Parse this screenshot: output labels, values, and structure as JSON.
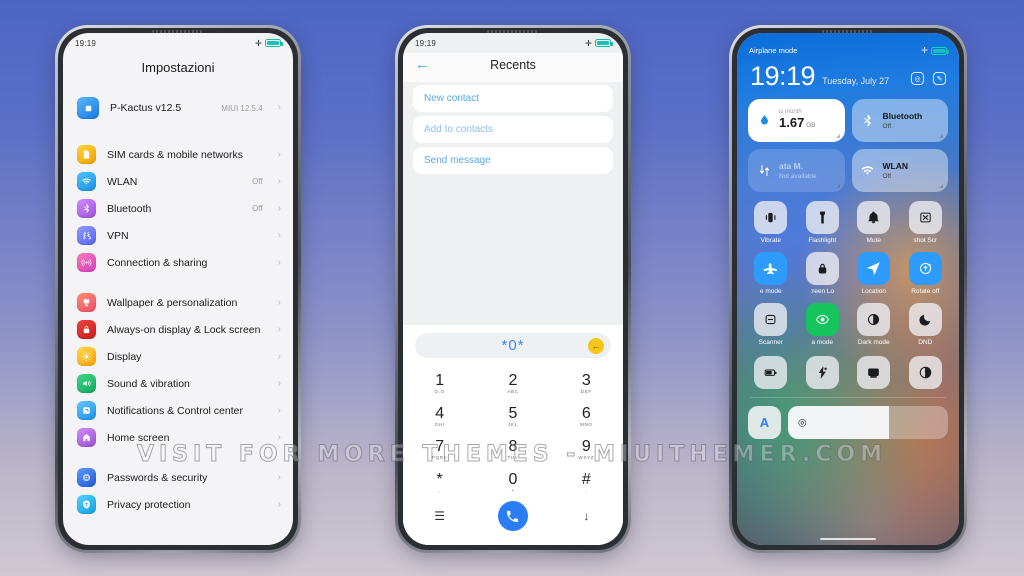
{
  "watermark": "VISIT FOR MORE THEMES - MIUITHEMER.COM",
  "phone1": {
    "status": {
      "time": "19:19"
    },
    "title": "Impostazioni",
    "header_row": {
      "label": "P-Kactus  v12.5",
      "value": "MIUI 12.5.4",
      "icon": "miui-logo-icon"
    },
    "groups": [
      {
        "items": [
          {
            "label": "SIM cards & mobile networks",
            "value": "",
            "icon": "sim-card-icon",
            "color1": "#ffd43b",
            "color2": "#f59f00"
          },
          {
            "label": "WLAN",
            "value": "Off",
            "icon": "wifi-icon",
            "color1": "#4dc4ff",
            "color2": "#1b8ee8"
          },
          {
            "label": "Bluetooth",
            "value": "Off",
            "icon": "bluetooth-icon",
            "color1": "#d28bff",
            "color2": "#9b51e0"
          },
          {
            "label": "VPN",
            "value": "",
            "icon": "vpn-icon",
            "color1": "#8f9bff",
            "color2": "#5a63f0"
          },
          {
            "label": "Connection & sharing",
            "value": "",
            "icon": "connection-sharing-icon",
            "color1": "#ff7ab8",
            "color2": "#d63ec2"
          }
        ]
      },
      {
        "items": [
          {
            "label": "Wallpaper & personalization",
            "value": "",
            "icon": "wallpaper-icon",
            "color1": "#ff8e6e",
            "color2": "#ee4f6f"
          },
          {
            "label": "Always-on display & Lock screen",
            "value": "",
            "icon": "lock-icon",
            "color1": "#f0413f",
            "color2": "#c71d1d"
          },
          {
            "label": "Display",
            "value": "",
            "icon": "brightness-icon",
            "color1": "#ffd84d",
            "color2": "#f7a307"
          },
          {
            "label": "Sound & vibration",
            "value": "",
            "icon": "speaker-icon",
            "color1": "#3fd88b",
            "color2": "#13a85c"
          },
          {
            "label": "Notifications & Control center",
            "value": "",
            "icon": "notifications-icon",
            "color1": "#62c6ff",
            "color2": "#1f8fe8"
          },
          {
            "label": "Home screen",
            "value": "",
            "icon": "home-icon",
            "color1": "#d08cf5",
            "color2": "#9b4fd6"
          }
        ]
      },
      {
        "items": [
          {
            "label": "Passwords & security",
            "value": "",
            "icon": "fingerprint-icon",
            "color1": "#5b9bff",
            "color2": "#2059d8"
          },
          {
            "label": "Privacy protection",
            "value": "",
            "icon": "shield-icon",
            "color1": "#4fd3ff",
            "color2": "#169fe0"
          }
        ]
      }
    ]
  },
  "phone2": {
    "status": {
      "time": "19:19"
    },
    "header": {
      "title": "Recents",
      "back_icon": "back-arrow-icon"
    },
    "options": [
      {
        "label": "New contact"
      },
      {
        "label": "Add to contacts"
      },
      {
        "label": "Send message"
      }
    ],
    "dialed_number": "*0*",
    "backspace_icon": "backspace-icon",
    "keys": [
      {
        "digit": "1",
        "letters": "O,O"
      },
      {
        "digit": "2",
        "letters": "ABC"
      },
      {
        "digit": "3",
        "letters": "DEF"
      },
      {
        "digit": "4",
        "letters": "GHI"
      },
      {
        "digit": "5",
        "letters": "JKL"
      },
      {
        "digit": "6",
        "letters": "MNO"
      },
      {
        "digit": "7",
        "letters": "PQRS"
      },
      {
        "digit": "8",
        "letters": "TUV"
      },
      {
        "digit": "9",
        "letters": "WXYZ"
      },
      {
        "digit": "*",
        "letters": ","
      },
      {
        "digit": "0",
        "letters": "+"
      },
      {
        "digit": "#",
        "letters": ";"
      }
    ],
    "bottom": {
      "menu_icon": "menu-icon",
      "call_icon": "phone-call-icon",
      "hide_icon": "arrow-down-icon"
    }
  },
  "phone3": {
    "status": {
      "label": "Airplane mode"
    },
    "clock": "19:19",
    "date": "Tuesday, July 27",
    "actions": [
      {
        "icon": "camera-icon"
      },
      {
        "icon": "edit-icon"
      }
    ],
    "big_tiles": [
      {
        "style": "white",
        "icon": "data-usage-icon",
        "header": "is month",
        "value": "1.67",
        "unit": "GB",
        "name": "",
        "sub": ""
      },
      {
        "style": "glass",
        "icon": "bluetooth-icon",
        "name": "Bluetooth",
        "sub": "Off"
      },
      {
        "style": "ghost",
        "icon": "mobile-data-icon",
        "name": "ata        M.",
        "sub": "Not available"
      },
      {
        "style": "glass",
        "icon": "wifi-icon",
        "name": "WLAN",
        "sub": "Off"
      }
    ],
    "toggles": [
      {
        "label": "Vibrate",
        "icon": "vibrate-icon",
        "state": "off"
      },
      {
        "label": "Flashlight",
        "icon": "flashlight-icon",
        "state": "off"
      },
      {
        "label": "Mute",
        "icon": "bell-icon",
        "state": "off"
      },
      {
        "label": "shot   Scr",
        "icon": "screenshot-icon",
        "state": "off"
      },
      {
        "label": "e mode",
        "icon": "airplane-icon",
        "state": "on"
      },
      {
        "label": ":reen    Lo",
        "icon": "padlock-icon",
        "state": "off"
      },
      {
        "label": "Location",
        "icon": "location-icon",
        "state": "on"
      },
      {
        "label": "Rotate off",
        "icon": "rotate-icon",
        "state": "on"
      },
      {
        "label": "Scanner",
        "icon": "scanner-icon",
        "state": "off"
      },
      {
        "label": "a mode",
        "icon": "eye-icon",
        "state": "green"
      },
      {
        "label": "Dark mode",
        "icon": "contrast-icon",
        "state": "off"
      },
      {
        "label": "DND",
        "icon": "moon-icon",
        "state": "off"
      }
    ],
    "toggles_row4": [
      {
        "label": "",
        "icon": "battery-saver-icon",
        "state": "off"
      },
      {
        "label": "",
        "icon": "cleaner-icon",
        "state": "off"
      },
      {
        "label": "",
        "icon": "cast-icon",
        "state": "off"
      },
      {
        "label": "",
        "icon": "reading-mode-icon",
        "state": "off"
      }
    ],
    "footer": {
      "letter": "A",
      "slider_icon": "brightness-slider-icon",
      "slider_percent": 63
    }
  }
}
